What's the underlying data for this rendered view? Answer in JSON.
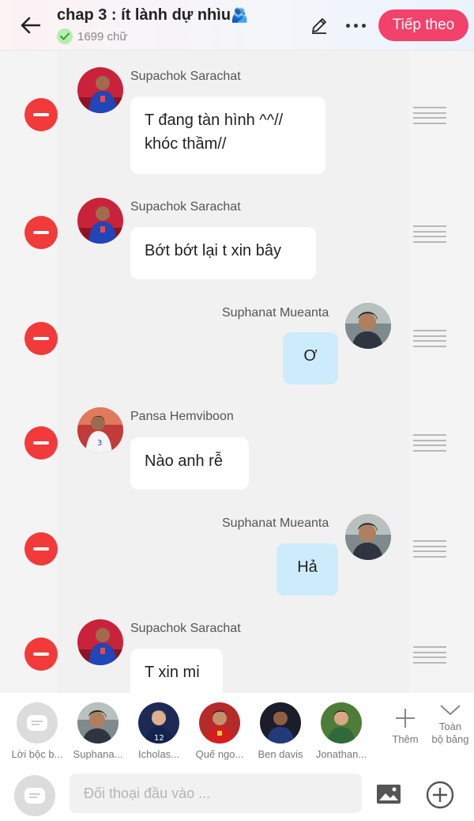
{
  "header": {
    "title": "chap 3 : ít lành dự nhìu",
    "title_emoji": "🫂",
    "word_count": "1699 chữ",
    "next_label": "Tiếp theo"
  },
  "messages": [
    {
      "sender": "Supachok Sarachat",
      "text_lines": [
        "T đang tàn hình ^^//",
        "khóc thầm//"
      ],
      "side": "left"
    },
    {
      "sender": "Supachok Sarachat",
      "text_lines": [
        "Bớt bớt lại t xin bây"
      ],
      "side": "left"
    },
    {
      "sender": "Suphanat Mueanta",
      "text_lines": [
        "Ơ"
      ],
      "side": "right"
    },
    {
      "sender": "Pansa Hemviboon",
      "text_lines": [
        "Nào anh rễ"
      ],
      "side": "left"
    },
    {
      "sender": "Suphanat Mueanta",
      "text_lines": [
        "Hả"
      ],
      "side": "right"
    },
    {
      "sender": "Supachok Sarachat",
      "text_lines": [
        "T xin mi"
      ],
      "side": "left"
    }
  ],
  "characters": [
    {
      "label": "Lời bộc b..."
    },
    {
      "label": "Suphana..."
    },
    {
      "label": "Icholas..."
    },
    {
      "label": "Quế ngo..."
    },
    {
      "label": "Ben davis"
    },
    {
      "label": "Jonathan..."
    }
  ],
  "char_actions": {
    "add_label": "Thêm",
    "all_board_line1": "Toàn",
    "all_board_line2": "bộ bảng"
  },
  "input": {
    "placeholder": "Đối thoại đầu vào ..."
  },
  "colors": {
    "accent": "#f2416a",
    "delete": "#f23a3a",
    "my_bubble": "#cdecfb"
  }
}
